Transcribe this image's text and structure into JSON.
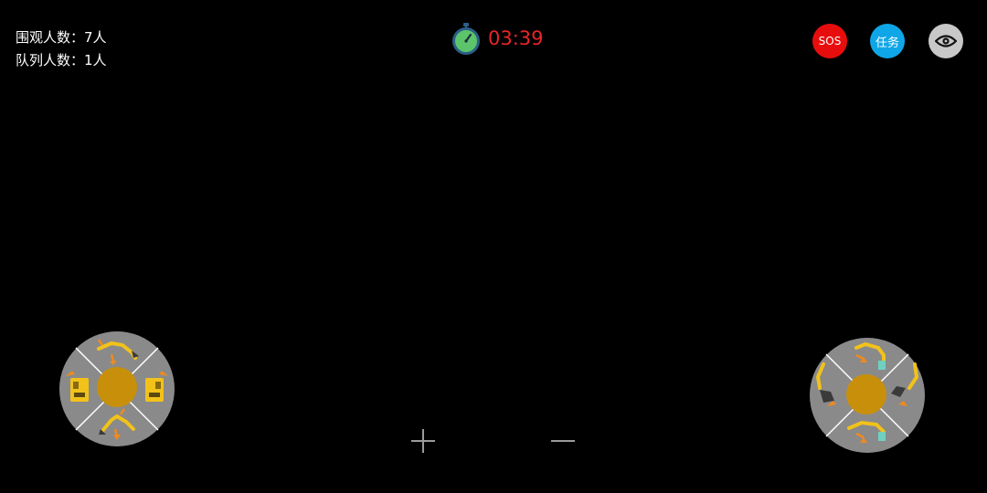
{
  "stats": {
    "spectators": "围观人数：7人",
    "queue": "队列人数：1人"
  },
  "timer": {
    "time": "03:39",
    "icon": "stopwatch-icon"
  },
  "buttons": {
    "sos": "SOS",
    "task": "任务",
    "view_icon": "eye-icon"
  },
  "joysticks": {
    "left": {
      "icons": [
        "boom-up-icon",
        "track-left-icon",
        "track-right-icon",
        "boom-down-icon"
      ]
    },
    "right": {
      "icons": [
        "arm-in-icon",
        "bucket-curl-icon",
        "bucket-dump-icon",
        "arm-out-icon"
      ]
    }
  },
  "zoom": {
    "plus_icon": "plus-icon",
    "minus_icon": "minus-icon"
  },
  "colors": {
    "background": "#000000",
    "timer_text": "#e8252b",
    "sos": "#e80d0d",
    "task": "#0fa6e8",
    "view": "#c8c8c8",
    "joystick_base": "#8a8a8a",
    "joystick_knob": "#c8900a",
    "excavator": "#f2c21a",
    "arrow": "#f08a1e"
  }
}
